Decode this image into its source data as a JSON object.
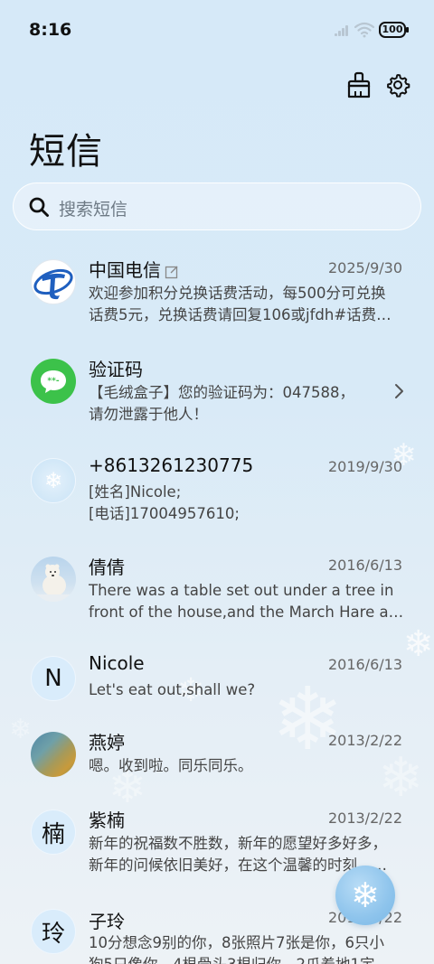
{
  "status_bar": {
    "time": "8:16",
    "battery": "100"
  },
  "header": {
    "title": "短信"
  },
  "search": {
    "placeholder": "搜索短信"
  },
  "messages": [
    {
      "name": "中国电信",
      "date": "2025/9/30",
      "line1": "欢迎参加积分兑换话费活动，每500分可兑换",
      "line2": "话费5元，兑换话费请回复106或jfdh#话费…",
      "avatar": "china-telecom-logo"
    },
    {
      "name": "验证码",
      "date": "",
      "line1": "【毛绒盒子】您的验证码为：047588，",
      "line2": "请勿泄露于他人！",
      "avatar": "message-bubble-icon"
    },
    {
      "name": "+8613261230775",
      "date": "2019/9/30",
      "line1": "[姓名]Nicole;",
      "line2": "[电话]17004957610;",
      "avatar": "snowflake-avatar"
    },
    {
      "name": "倩倩",
      "date": "2016/6/13",
      "line1": "There was a table set out under a tree in",
      "line2": "front of the house,and the March Hare an…",
      "avatar": "polar-bear-photo"
    },
    {
      "name": "Nicole",
      "date": "2016/6/13",
      "line1": "Let's eat out,shall we?",
      "line2": "",
      "avatar": "letter",
      "letter": "N"
    },
    {
      "name": "燕婷",
      "date": "2013/2/22",
      "line1": "嗯。收到啦。同乐同乐。",
      "line2": "",
      "avatar": "landscape-photo"
    },
    {
      "name": "紫楠",
      "date": "2013/2/22",
      "line1": "新年的祝福数不胜数，新年的愿望好多好多，",
      "line2": "新年的问候依旧美好，在这个温馨的时刻，…",
      "avatar": "letter",
      "letter": "楠"
    },
    {
      "name": "子玲",
      "date": "2013/2/22",
      "line1": "10分想念9别的你，8张照片7张是你，6只小",
      "line2": "狗5只像你，4根骨头3根归你，2爪着地1定",
      "avatar": "letter",
      "letter": "玲"
    }
  ],
  "colors": {
    "telecom_blue": "#1f5fbf",
    "bubble_green": "#3cc24a",
    "accent": "#8ec4ec"
  }
}
